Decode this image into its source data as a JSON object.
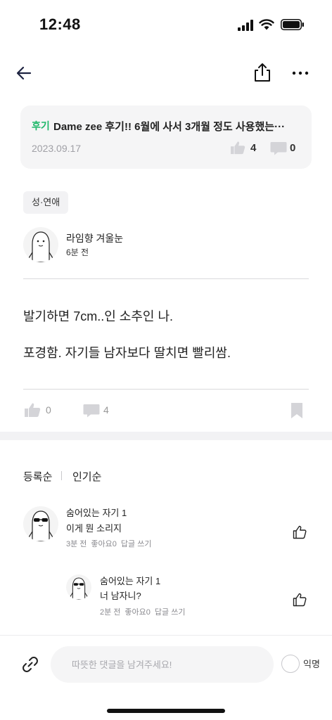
{
  "status_bar": {
    "time": "12:48"
  },
  "review": {
    "tag": "후기",
    "title": "Dame zee 후기!! 6월에 사서 3개월 정도 사용했는···",
    "date": "2023.09.17",
    "likes": "4",
    "comments": "0"
  },
  "post": {
    "category": "성·연애",
    "author": "라임향 겨울눈",
    "time_ago": "6분 전",
    "body": [
      "발기하면 7cm..인 소추인 나.",
      "포경함.  자기들 남자보다 딸치면 빨리쌈."
    ],
    "likes": "0",
    "comments": "4"
  },
  "sort": {
    "options": [
      "등록순",
      "인기순"
    ]
  },
  "comments": [
    {
      "author": "숨어있는 자기 1",
      "text": "이게 뭔 소리지",
      "time": "3분 전",
      "likes": "좋아요0",
      "reply": "답글 쓰기"
    },
    {
      "author": "숨어있는 자기 1",
      "text": "너 남자니?",
      "time": "2분 전",
      "likes": "좋아요0",
      "reply": "답글 쓰기"
    }
  ],
  "composer": {
    "placeholder": "따뜻한 댓글을 남겨주세요!",
    "anonymous_label": "익명"
  },
  "icons": {
    "back": "arrow-left-icon",
    "share": "share-icon",
    "more": "more-icon",
    "like": "thumbs-up-icon",
    "comment": "speech-bubble-icon",
    "bookmark": "bookmark-icon",
    "attach": "paperclip-icon"
  },
  "colors": {
    "accent_green": "#1fb86a",
    "card_background": "#f5f5f6",
    "muted_icon": "#d4d4d8"
  }
}
